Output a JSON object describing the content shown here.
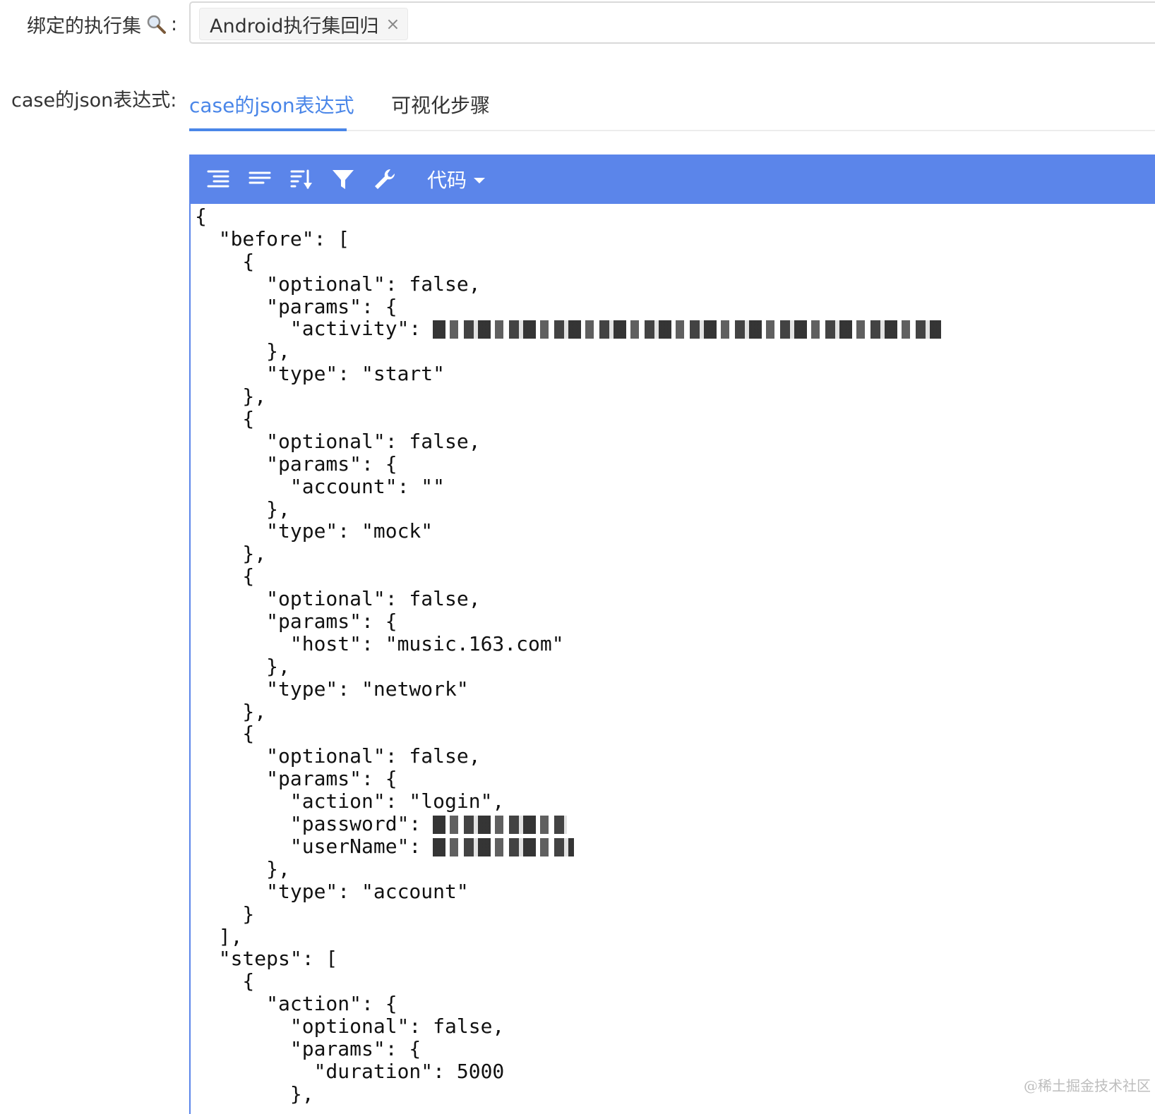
{
  "form": {
    "exec_set_label": "绑定的执行集",
    "exec_set_colon": ":",
    "exec_set_tag": "Android执行集回归",
    "exec_set_tag_close": "×",
    "json_label": "case的json表达式:"
  },
  "tabs": {
    "active": "case的json表达式",
    "inactive": "可视化步骤"
  },
  "editor": {
    "menu": {
      "icons": [
        "format-icon",
        "compact-icon",
        "sort-icon",
        "filter-icon",
        "repair-icon"
      ],
      "mode_label": "代码"
    },
    "lines": [
      "{",
      "  \"before\": [",
      "    {",
      "      \"optional\": false,",
      "      \"params\": {",
      "        \"activity\": ",
      "      },",
      "      \"type\": \"start\"",
      "    },",
      "    {",
      "      \"optional\": false,",
      "      \"params\": {",
      "        \"account\": \"\"",
      "      },",
      "      \"type\": \"mock\"",
      "    },",
      "    {",
      "      \"optional\": false,",
      "      \"params\": {",
      "        \"host\": \"music.163.com\"",
      "      },",
      "      \"type\": \"network\"",
      "    },",
      "    {",
      "      \"optional\": false,",
      "      \"params\": {",
      "        \"action\": \"login\",",
      "        \"password\": ",
      "        \"userName\": ",
      "      },",
      "      \"type\": \"account\"",
      "    }",
      "  ],",
      "  \"steps\": [",
      "    {",
      "      \"action\": {",
      "        \"optional\": false,",
      "        \"params\": {",
      "          \"duration\": 5000",
      "        },"
    ]
  },
  "watermark": "@稀土掘金技术社区",
  "colors": {
    "accent": "#4a86e8",
    "menu_bg": "#5b85ea"
  }
}
